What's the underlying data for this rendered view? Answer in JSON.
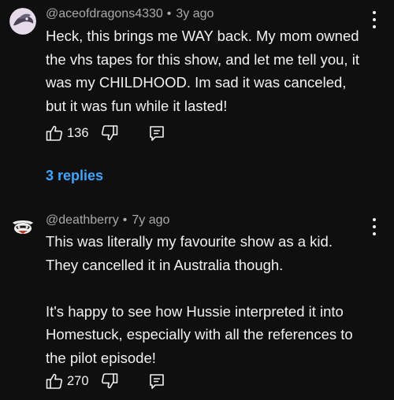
{
  "comments": [
    {
      "author": "@aceofdragons4330",
      "time": "3y ago",
      "text_lines": [
        "Heck, this brings me WAY back. My mom owned",
        "the vhs tapes for this show, and let me tell you, it",
        "was my CHILDHOOD. Im sad it was canceled,",
        "but it was fun while it lasted!"
      ],
      "likes": "136",
      "replies_label": "3 replies",
      "avatar_color": "#d9c7e3"
    },
    {
      "author": "@deathberry",
      "time": "7y ago",
      "text_lines": [
        "This was literally my favourite show as a kid.",
        "They cancelled it in Australia though.",
        "",
        "It's happy to see how Hussie interpreted it into",
        "Homestuck, especially with all the references to",
        "the pilot episode!"
      ],
      "likes": "270",
      "avatar_color": "#ffffff"
    }
  ],
  "separator": "•",
  "icons": {
    "like": "thumbs-up-icon",
    "dislike": "thumbs-down-icon",
    "reply": "reply-icon",
    "menu": "more-vertical-icon"
  },
  "colors": {
    "background": "#0f0f0f",
    "text": "#f1f1f1",
    "meta": "#aaaaaa",
    "link": "#3ea6ff"
  }
}
